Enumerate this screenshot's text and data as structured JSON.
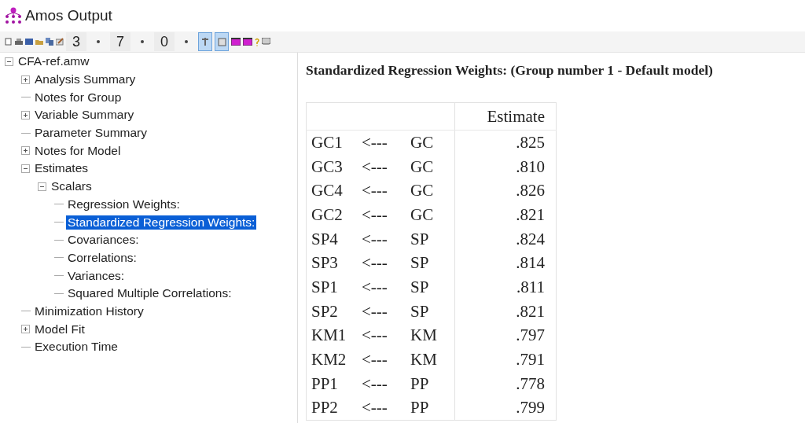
{
  "window": {
    "title": "Amos Output"
  },
  "toolbar": {
    "decimals": [
      {
        "value": "3"
      },
      {
        "value": "7"
      },
      {
        "value": "0"
      }
    ],
    "toggles": [
      {
        "selected": true
      },
      {
        "selected": true
      }
    ]
  },
  "tree": [
    {
      "label": "CFA-ref.amw",
      "expanded": true,
      "selected": false,
      "children": [
        {
          "label": "Analysis Summary",
          "expanded": false,
          "selected": false
        },
        {
          "label": "Notes for Group",
          "selected": false
        },
        {
          "label": "Variable Summary",
          "expanded": false,
          "selected": false
        },
        {
          "label": "Parameter Summary",
          "selected": false
        },
        {
          "label": "Notes for Model",
          "expanded": false,
          "selected": false
        },
        {
          "label": "Estimates",
          "expanded": true,
          "selected": false,
          "children": [
            {
              "label": "Scalars",
              "expanded": true,
              "selected": false,
              "children": [
                {
                  "label": "Regression Weights:",
                  "selected": false
                },
                {
                  "label": "Standardized Regression Weights:",
                  "selected": true
                },
                {
                  "label": "Covariances:",
                  "selected": false
                },
                {
                  "label": "Correlations:",
                  "selected": false
                },
                {
                  "label": "Variances:",
                  "selected": false
                },
                {
                  "label": "Squared Multiple Correlations:",
                  "selected": false
                }
              ]
            }
          ]
        },
        {
          "label": "Minimization History",
          "selected": false
        },
        {
          "label": "Model Fit",
          "expanded": false,
          "selected": false
        },
        {
          "label": "Execution Time",
          "selected": false
        }
      ]
    }
  ],
  "output": {
    "heading": "Standardized Regression Weights: (Group number 1 - Default model)",
    "table": {
      "columns": [
        "Estimate"
      ],
      "rows": [
        {
          "column_1": "GC1",
          "column_2": "<---",
          "column_3": "GC",
          "estimate": ".825"
        },
        {
          "column_1": "GC3",
          "column_2": "<---",
          "column_3": "GC",
          "estimate": ".810"
        },
        {
          "column_1": "GC4",
          "column_2": "<---",
          "column_3": "GC",
          "estimate": ".826"
        },
        {
          "column_1": "GC2",
          "column_2": "<---",
          "column_3": "GC",
          "estimate": ".821"
        },
        {
          "column_1": "SP4",
          "column_2": "<---",
          "column_3": "SP",
          "estimate": ".824"
        },
        {
          "column_1": "SP3",
          "column_2": "<---",
          "column_3": "SP",
          "estimate": ".814"
        },
        {
          "column_1": "SP1",
          "column_2": "<---",
          "column_3": "SP",
          "estimate": ".811"
        },
        {
          "column_1": "SP2",
          "column_2": "<---",
          "column_3": "SP",
          "estimate": ".821"
        },
        {
          "column_1": "KM1",
          "column_2": "<---",
          "column_3": "KM",
          "estimate": ".797"
        },
        {
          "column_1": "KM2",
          "column_2": "<---",
          "column_3": "KM",
          "estimate": ".791"
        },
        {
          "column_1": "PP1",
          "column_2": "<---",
          "column_3": "PP",
          "estimate": ".778"
        },
        {
          "column_1": "PP2",
          "column_2": "<---",
          "column_3": "PP",
          "estimate": ".799"
        }
      ]
    }
  }
}
